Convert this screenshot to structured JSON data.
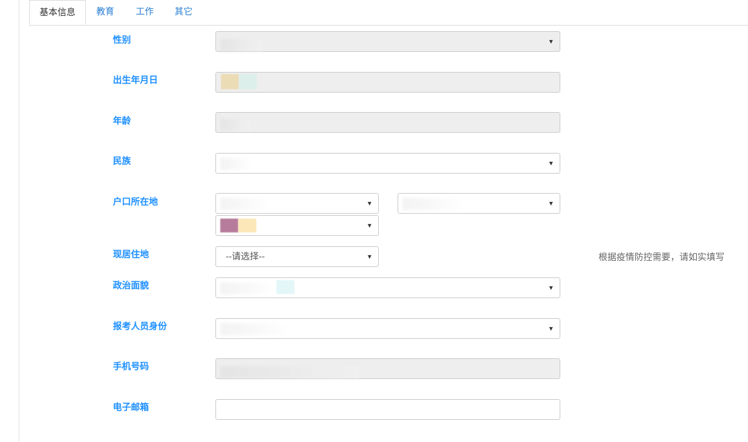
{
  "tabs": [
    {
      "label": "基本信息",
      "active": true
    },
    {
      "label": "教育",
      "active": false
    },
    {
      "label": "工作",
      "active": false
    },
    {
      "label": "其它",
      "active": false
    }
  ],
  "fields": {
    "gender": {
      "label": "性别"
    },
    "birth_date": {
      "label": "出生年月日"
    },
    "age": {
      "label": "年龄"
    },
    "ethnicity": {
      "label": "民族"
    },
    "household": {
      "label": "户口所在地"
    },
    "residence": {
      "label": "现居住地",
      "value": "--请选择--"
    },
    "political_status": {
      "label": "政治面貌"
    },
    "applicant_identity": {
      "label": "报考人员身份"
    },
    "phone": {
      "label": "手机号码"
    },
    "email": {
      "label": "电子邮箱"
    }
  },
  "residence_note": "根据疫情防控需要，请如实填写",
  "colors": {
    "label_blue": "#1e90ff",
    "tab_link": "#2a7fd4",
    "readonly_bg": "#eeeeee",
    "border": "#cccccc"
  },
  "icons": {
    "dropdown": "caret-down-icon"
  }
}
